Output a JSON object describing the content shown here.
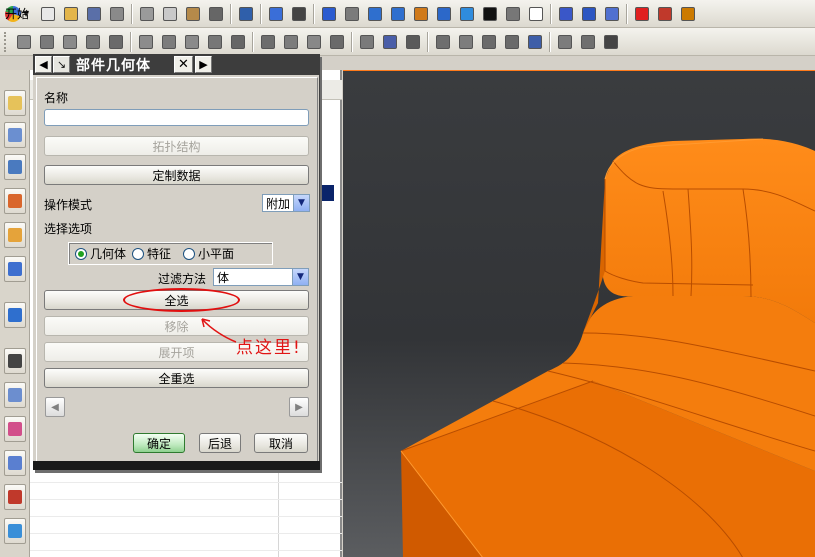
{
  "toolbar": {
    "start_label": "开始",
    "row1_icons": [
      {
        "name": "new-file-icon",
        "color": "#e8e8e8"
      },
      {
        "name": "open-folder-icon",
        "color": "#e3b54a"
      },
      {
        "name": "save-icon",
        "color": "#5a6fa8"
      },
      {
        "name": "print-icon",
        "color": "#8a8a8a"
      },
      {
        "name": "cut-icon",
        "color": "#9a9a9a"
      },
      {
        "name": "copy-icon",
        "color": "#c9c9c9"
      },
      {
        "name": "paste-icon",
        "color": "#b58a4a"
      },
      {
        "name": "delete-icon",
        "color": "#666666"
      },
      {
        "name": "undo-icon",
        "color": "#2f5faa"
      },
      {
        "name": "selection-filter-icon",
        "color": "#3a6ed8"
      },
      {
        "name": "view-menu-icon",
        "color": "#444444"
      },
      {
        "name": "fit-icon",
        "color": "#2b5bd0"
      },
      {
        "name": "zoom-window-icon",
        "color": "#7b7b7b"
      },
      {
        "name": "zoom-icon",
        "color": "#2f6fce"
      },
      {
        "name": "zoom-in-out-icon",
        "color": "#2f6fce"
      },
      {
        "name": "pan-icon",
        "color": "#d07a1a"
      },
      {
        "name": "rotate-icon",
        "color": "#2c68c9"
      },
      {
        "name": "shaded-cube-icon",
        "color": "#2f8cdd"
      },
      {
        "name": "rendering-style-icon",
        "color": "#111111"
      },
      {
        "name": "lighting-icon",
        "color": "#777777"
      },
      {
        "name": "background-icon",
        "color": "#ffffff"
      },
      {
        "name": "wcs-icon",
        "color": "#3a57c8"
      },
      {
        "name": "csys-icon",
        "color": "#2c56c2"
      },
      {
        "name": "orient-icon",
        "color": "#5070d0"
      },
      {
        "name": "snap-icon",
        "color": "#e02020"
      },
      {
        "name": "point-icon",
        "color": "#c0392b"
      },
      {
        "name": "layer-icon",
        "color": "#cc7a00"
      }
    ],
    "row2_icons": [
      {
        "name": "op-nav-icon",
        "color": "#8b8b8b"
      },
      {
        "name": "program-order-icon",
        "color": "#7a7a7a"
      },
      {
        "name": "machine-tool-icon",
        "color": "#8a8a8a"
      },
      {
        "name": "geometry-view-icon",
        "color": "#7a7a7a"
      },
      {
        "name": "method-view-icon",
        "color": "#6a6a6a"
      },
      {
        "name": "create-program-icon",
        "color": "#8c8c8c"
      },
      {
        "name": "create-tool-icon",
        "color": "#7c7c7c"
      },
      {
        "name": "create-geometry-icon",
        "color": "#8a8a8a"
      },
      {
        "name": "create-method-icon",
        "color": "#777777"
      },
      {
        "name": "create-operation-icon",
        "color": "#666666"
      },
      {
        "name": "generate-toolpath-icon",
        "color": "#6d6d6d"
      },
      {
        "name": "replay-icon",
        "color": "#7c7c7c"
      },
      {
        "name": "verify-icon",
        "color": "#888888"
      },
      {
        "name": "simulate-icon",
        "color": "#6a6a6a"
      },
      {
        "name": "post-process-icon",
        "color": "#7a7a7a"
      },
      {
        "name": "shop-docs-icon",
        "color": "#4a5ea8"
      },
      {
        "name": "output-cls-icon",
        "color": "#5a5a5a"
      },
      {
        "name": "edit-object-icon",
        "color": "#6e6e6e"
      },
      {
        "name": "cut-object-icon",
        "color": "#7d7d7d"
      },
      {
        "name": "copy-object-icon",
        "color": "#6a6a6a"
      },
      {
        "name": "paste-object-icon",
        "color": "#6a6a6a"
      },
      {
        "name": "info-icon",
        "color": "#3e5ea8"
      },
      {
        "name": "feed-speed-icon",
        "color": "#7c7c7c"
      },
      {
        "name": "tool-library-icon",
        "color": "#6f6f6f"
      },
      {
        "name": "object-delete-icon",
        "color": "#444444"
      }
    ]
  },
  "resource_bar": {
    "icons": [
      "assembly-navigator-icon",
      "part-navigator-icon",
      "operation-navigator-icon",
      "constraint-navigator-icon",
      "reuse-library-icon",
      "sequence-navigator-icon",
      "web-browser-icon",
      "history-icon",
      "process-studio-icon",
      "visualization-icon",
      "manufacturing-wizard-icon",
      "roles-icon",
      "system-materials-icon"
    ]
  },
  "dialog": {
    "title": "部件几何体",
    "name_label": "名称",
    "name_value": "",
    "topology_button": "拓扑结构",
    "custom_data_button": "定制数据",
    "op_mode_label": "操作模式",
    "op_mode_value": "附加",
    "select_options_label": "选择选项",
    "radio_options": [
      {
        "label": "几何体",
        "selected": true
      },
      {
        "label": "特征",
        "selected": false
      },
      {
        "label": "小平面",
        "selected": false
      }
    ],
    "filter_label": "过滤方法",
    "filter_value": "体",
    "select_all_button": "全选",
    "remove_button": "移除",
    "expand_button": "展开项",
    "reselect_all_button": "全重选",
    "ok_button": "确定",
    "back_button": "后退",
    "cancel_button": "取消"
  },
  "annotation": {
    "text": "点这里!",
    "color": "#e11414"
  }
}
